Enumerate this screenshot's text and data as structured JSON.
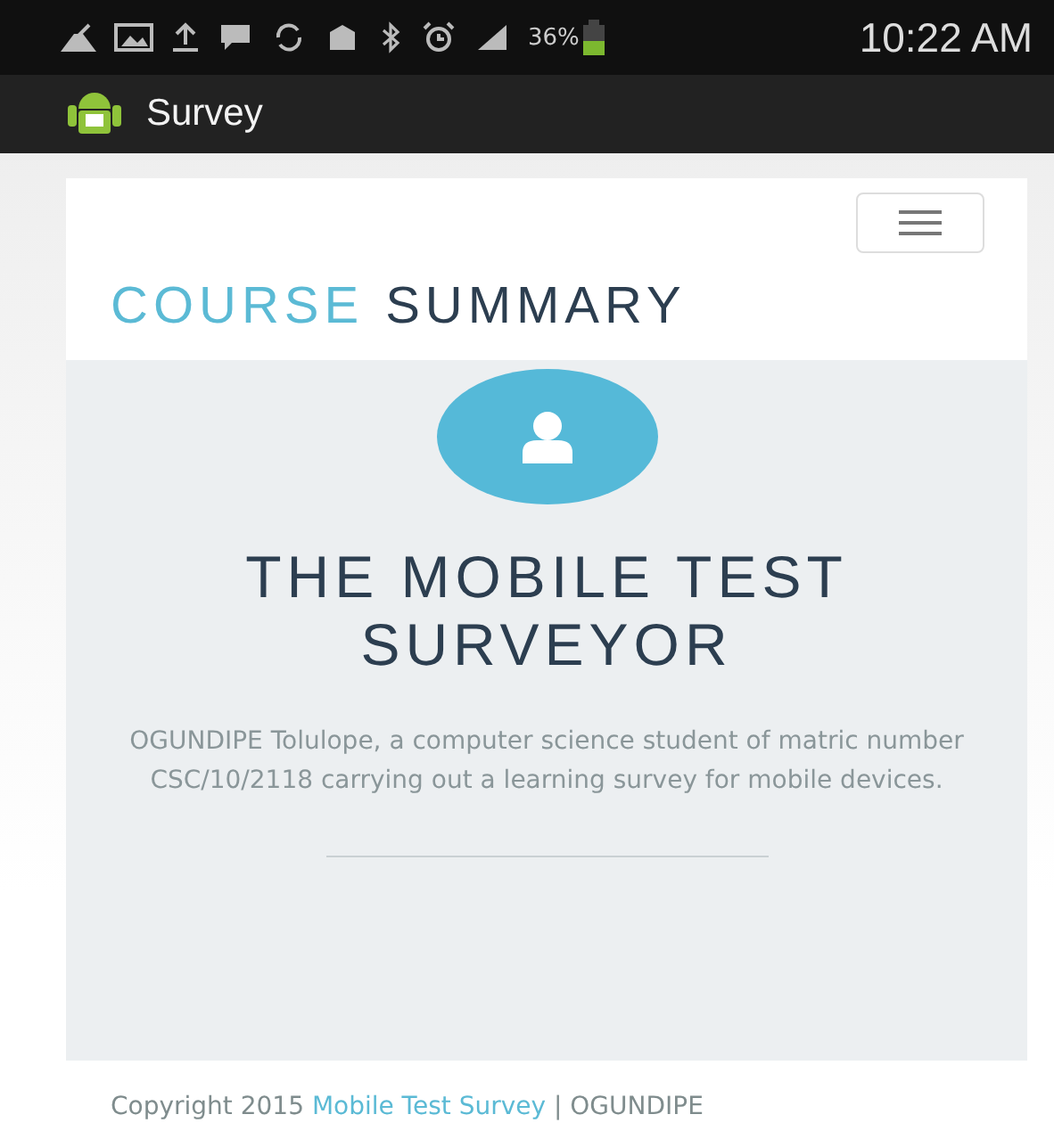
{
  "status_bar": {
    "battery": "36%",
    "time": "10:22 AM"
  },
  "app_bar": {
    "title": "Survey"
  },
  "header": {
    "brand": [
      {
        "text": "COURSE",
        "kind": "accent"
      },
      {
        "text": "SUMMARY",
        "kind": "plain"
      }
    ]
  },
  "hero": {
    "title": "THE MOBILE TEST SURVEYOR",
    "description": "OGUNDIPE Tolulope, a computer science student of matric number CSC/10/2118 carrying out a learning survey for mobile devices."
  },
  "footer": {
    "prefix": "Copyright 2015 ",
    "link": "Mobile Test Survey",
    "suffix": " | OGUNDIPE"
  }
}
